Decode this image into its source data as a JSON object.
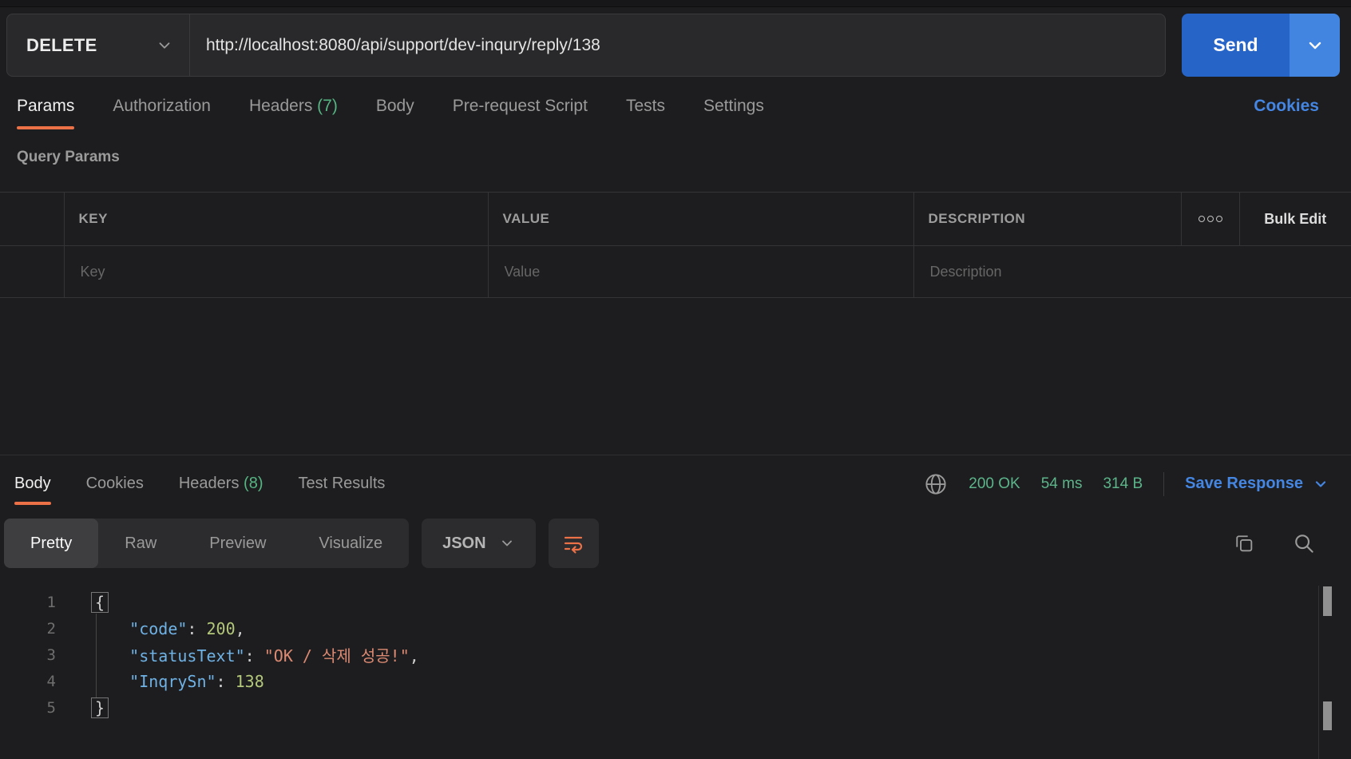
{
  "request": {
    "method": "DELETE",
    "url": "http://localhost:8080/api/support/dev-inqury/reply/138",
    "send_label": "Send"
  },
  "request_tabs": {
    "items": [
      {
        "label": "Params"
      },
      {
        "label": "Authorization"
      },
      {
        "label": "Headers",
        "count": "(7)"
      },
      {
        "label": "Body"
      },
      {
        "label": "Pre-request Script"
      },
      {
        "label": "Tests"
      },
      {
        "label": "Settings"
      }
    ],
    "cookies_link": "Cookies"
  },
  "query_params": {
    "section_title": "Query Params",
    "columns": {
      "key": "KEY",
      "value": "VALUE",
      "description": "DESCRIPTION"
    },
    "bulk_edit_label": "Bulk Edit",
    "row_placeholders": {
      "key": "Key",
      "value": "Value",
      "description": "Description"
    }
  },
  "response": {
    "tabs": [
      {
        "label": "Body"
      },
      {
        "label": "Cookies"
      },
      {
        "label": "Headers",
        "count": "(8)"
      },
      {
        "label": "Test Results"
      }
    ],
    "status": {
      "code": "200 OK",
      "time": "54 ms",
      "size": "314 B"
    },
    "save_response_label": "Save Response",
    "view_tabs": [
      "Pretty",
      "Raw",
      "Preview",
      "Visualize"
    ],
    "active_view": "Pretty",
    "language": "JSON",
    "body_lines": [
      {
        "number": "1",
        "tokens": [
          {
            "text": "{",
            "type": "brace-box"
          }
        ]
      },
      {
        "number": "2",
        "tokens": [
          {
            "text": "    ",
            "type": "plain"
          },
          {
            "text": "\"code\"",
            "type": "key"
          },
          {
            "text": ": ",
            "type": "punct"
          },
          {
            "text": "200",
            "type": "number"
          },
          {
            "text": ",",
            "type": "punct"
          }
        ]
      },
      {
        "number": "3",
        "tokens": [
          {
            "text": "    ",
            "type": "plain"
          },
          {
            "text": "\"statusText\"",
            "type": "key"
          },
          {
            "text": ": ",
            "type": "punct"
          },
          {
            "text": "\"OK / 삭제 성공!\"",
            "type": "string"
          },
          {
            "text": ",",
            "type": "punct"
          }
        ]
      },
      {
        "number": "4",
        "tokens": [
          {
            "text": "    ",
            "type": "plain"
          },
          {
            "text": "\"InqrySn\"",
            "type": "key"
          },
          {
            "text": ": ",
            "type": "punct"
          },
          {
            "text": "138",
            "type": "number"
          }
        ]
      },
      {
        "number": "5",
        "tokens": [
          {
            "text": "}",
            "type": "brace-box"
          }
        ]
      }
    ]
  },
  "icons": {
    "method_caret": "chevron-down",
    "send_caret": "chevron-down",
    "more_options": "three-circles",
    "network": "globe",
    "save_caret": "chevron-down",
    "json_caret": "chevron-down",
    "wrap_line": "wrap-text",
    "copy": "overlapping-squares",
    "search": "magnifier"
  },
  "colors": {
    "accent_orange": "#ed7147",
    "status_green": "#5cb58a",
    "count_green": "#55b583",
    "link_blue": "#4486e2",
    "send_blue": "#2764c8",
    "send_caret_blue": "#4285e0",
    "token_key": "#6fb2e5",
    "token_number": "#b3c87a",
    "token_string": "#dd8a72"
  }
}
